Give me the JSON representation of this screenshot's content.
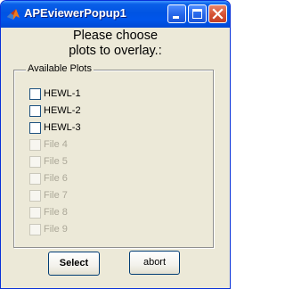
{
  "window": {
    "title": "APEviewerPopup1",
    "app_icon": "matlab-icon",
    "controls": [
      "minimize-icon",
      "maximize-icon",
      "close-icon"
    ]
  },
  "prompt": {
    "line1": "Please choose",
    "line2": "plots to overlay.:"
  },
  "group": {
    "title": "Available Plots",
    "items": [
      {
        "label": "HEWL-1",
        "enabled": true,
        "checked": false
      },
      {
        "label": "HEWL-2",
        "enabled": true,
        "checked": false
      },
      {
        "label": "HEWL-3",
        "enabled": true,
        "checked": false
      },
      {
        "label": "File 4",
        "enabled": false,
        "checked": false
      },
      {
        "label": "File 5",
        "enabled": false,
        "checked": false
      },
      {
        "label": "File 6",
        "enabled": false,
        "checked": false
      },
      {
        "label": "File 7",
        "enabled": false,
        "checked": false
      },
      {
        "label": "File 8",
        "enabled": false,
        "checked": false
      },
      {
        "label": "File 9",
        "enabled": false,
        "checked": false
      }
    ]
  },
  "buttons": {
    "select_label": "Select",
    "abort_label": "abort"
  },
  "colors": {
    "titlebar": "#0054e3",
    "client_bg": "#ece9d8",
    "disabled_text": "#aca899",
    "close_button": "#d45133"
  }
}
